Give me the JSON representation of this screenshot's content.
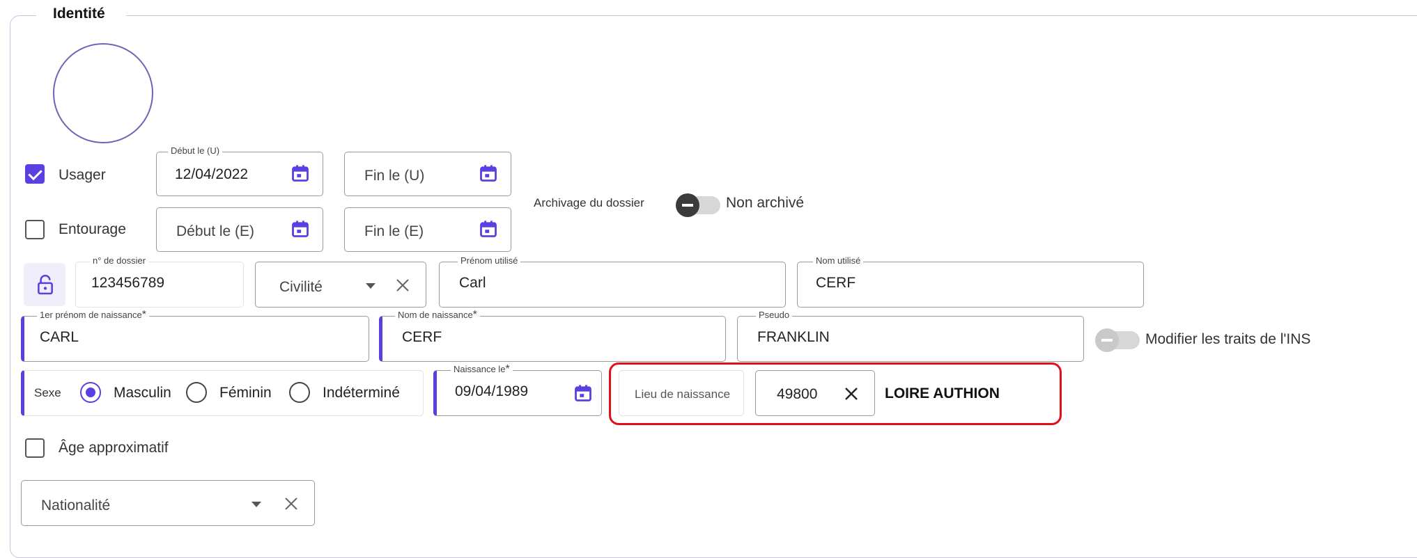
{
  "section": {
    "title": "Identité"
  },
  "usager": {
    "label": "Usager",
    "checked": true,
    "debut": {
      "label": "Début le (U)",
      "value": "12/04/2022"
    },
    "fin": {
      "placeholder": "Fin le (U)"
    }
  },
  "entourage": {
    "label": "Entourage",
    "checked": false,
    "debut": {
      "placeholder": "Début le (E)"
    },
    "fin": {
      "placeholder": "Fin le (E)"
    }
  },
  "archivage": {
    "label": "Archivage du dossier",
    "status": "Non archivé"
  },
  "dossier": {
    "label": "n° de dossier",
    "value": "123456789"
  },
  "civilite": {
    "placeholder": "Civilité"
  },
  "prenom_utilise": {
    "label": "Prénom utilisé",
    "value": "Carl"
  },
  "nom_utilise": {
    "label": "Nom utilisé",
    "value": "CERF"
  },
  "premier_prenom": {
    "label": "1er prénom de naissance",
    "value": "CARL"
  },
  "nom_naissance": {
    "label": "Nom de naissance",
    "value": "CERF"
  },
  "pseudo": {
    "label": "Pseudo",
    "value": "FRANKLIN"
  },
  "ins": {
    "label": "Modifier les traits de l'INS"
  },
  "sexe": {
    "label": "Sexe",
    "options": [
      "Masculin",
      "Féminin",
      "Indéterminé"
    ],
    "selected": "Masculin"
  },
  "naissance": {
    "label": "Naissance le",
    "value": "09/04/1989"
  },
  "lieu": {
    "label": "Lieu de naissance",
    "code": "49800",
    "city": "LOIRE AUTHION"
  },
  "age_approx": {
    "label": "Âge approximatif",
    "checked": false
  },
  "nationalite": {
    "placeholder": "Nationalité"
  },
  "required_mark": "*",
  "colors": {
    "accent": "#5b3fe0",
    "highlight": "#e0101a"
  },
  "icons": [
    "calendar-icon",
    "lock-icon",
    "chevron-down-icon",
    "close-icon"
  ]
}
